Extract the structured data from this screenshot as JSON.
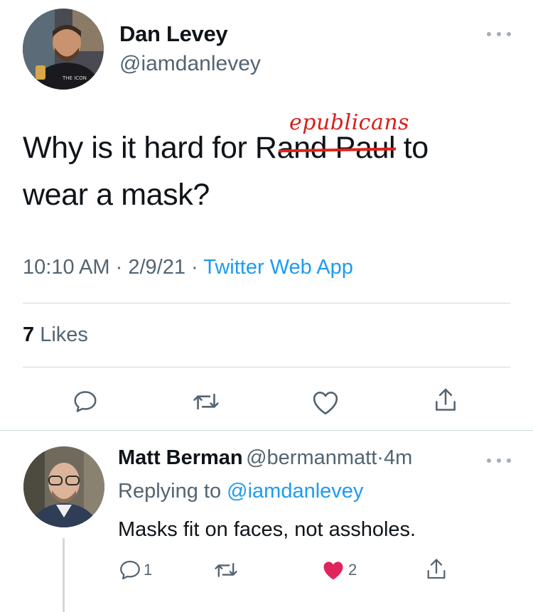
{
  "tweet": {
    "author": {
      "name": "Dan Levey",
      "handle": "@iamdanlevey"
    },
    "text_before": "Why is it hard for R",
    "struck_text": "and Paul",
    "handwritten_correction": "epublicans",
    "text_after": " to",
    "text_line2": "wear a mask?",
    "time": "10:10 AM",
    "date": "2/9/21",
    "separator": "·",
    "source": "Twitter Web App",
    "likes_count": "7",
    "likes_label": "Likes"
  },
  "reply": {
    "author": {
      "name": "Matt Berman",
      "handle": "@bermanmatt"
    },
    "separator": "·",
    "time_ago": "4m",
    "replying_prefix": "Replying to ",
    "replying_to": "@iamdanlevey",
    "text": "Masks fit on faces, not assholes.",
    "reply_count": "1",
    "like_count": "2"
  },
  "colors": {
    "accent": "#1d9bf0",
    "like_red": "#e0245e",
    "strike_red": "#e0221b"
  },
  "icons": [
    "more-icon",
    "reply-icon",
    "retweet-icon",
    "like-icon",
    "share-icon"
  ]
}
